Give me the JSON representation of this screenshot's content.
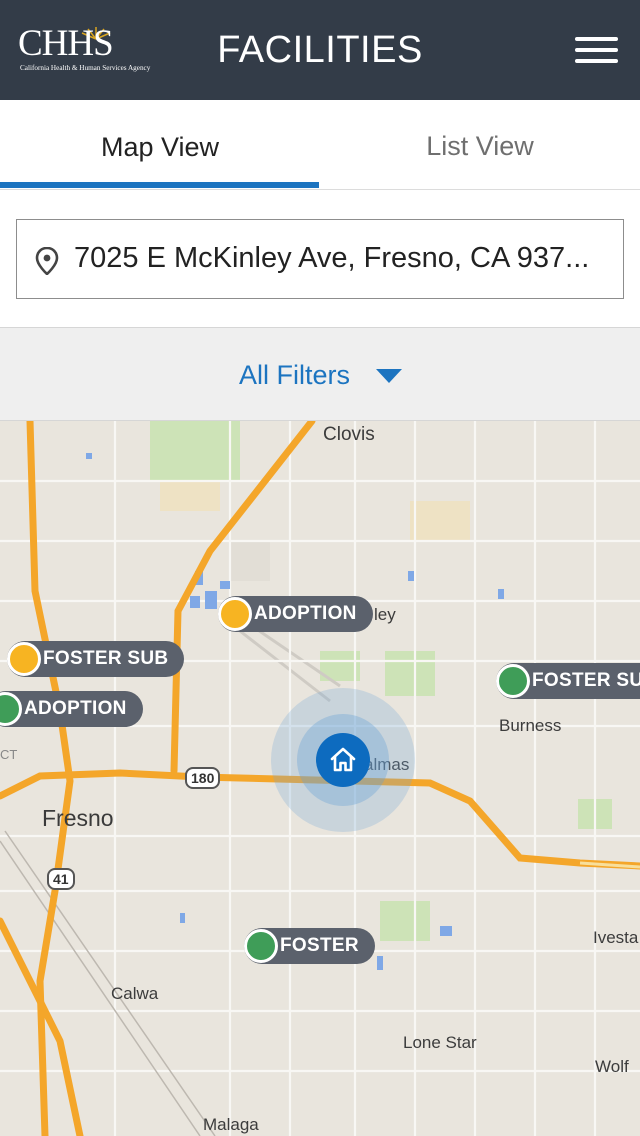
{
  "header": {
    "logo": {
      "name": "logo-chhs",
      "text": "CHHS",
      "subtitle": "California Health & Human Services Agency"
    },
    "title": "FACILITIES",
    "menu_icon": "hamburger-menu-icon",
    "colors": {
      "background": "#333c48",
      "text": "#ffffff"
    }
  },
  "tabs": [
    {
      "label": "Map View",
      "active": true
    },
    {
      "label": "List View",
      "active": false
    }
  ],
  "search": {
    "icon": "location-pin-icon",
    "value": "7025 E McKinley Ave, Fresno, CA 937..."
  },
  "filters": {
    "label": "All Filters",
    "icon": "caret-down-icon"
  },
  "map": {
    "places": {
      "clovis": "Clovis",
      "fresno": "Fresno",
      "burness": "Burness",
      "calwa": "Calwa",
      "lone_star": "Lone Star",
      "wolf": "Wolf",
      "malaga": "Malaga",
      "ivesta": "Ivesta",
      "palmas": "almas",
      "ley": "ley",
      "ct": "CT"
    },
    "highways": {
      "h180": "180",
      "h41": "41"
    },
    "markers": [
      {
        "label": "ADOPTION",
        "type": "yellow"
      },
      {
        "label": "FOSTER SUB",
        "type": "yellow"
      },
      {
        "label": "ADOPTION",
        "type": "green"
      },
      {
        "label": "FOSTER SUB",
        "type": "green"
      },
      {
        "label": "FOSTER",
        "type": "green"
      }
    ],
    "home_icon": "home-icon",
    "colors": {
      "accent": "#1c74c0",
      "marker_yellow": "#f7b422",
      "marker_green": "#3f9d58",
      "highway": "#f4a62a"
    }
  }
}
